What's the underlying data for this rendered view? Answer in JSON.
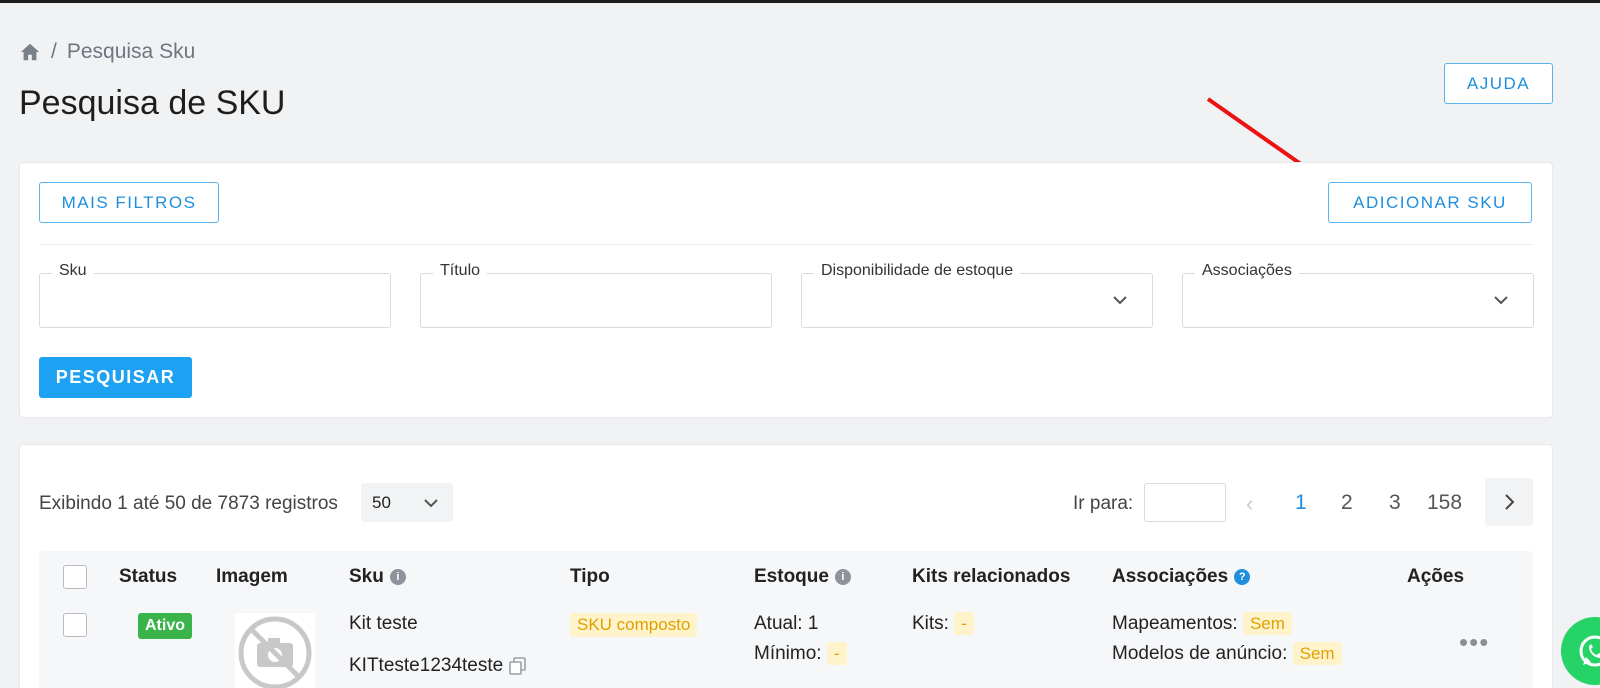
{
  "breadcrumb": {
    "home_icon": "home-icon",
    "separator": "/",
    "current": "Pesquisa Sku"
  },
  "page": {
    "title": "Pesquisa de SKU"
  },
  "header": {
    "help_label": "AJUDA"
  },
  "filters": {
    "more_filters_label": "MAIS FILTROS",
    "add_sku_label": "ADICIONAR SKU",
    "fields": [
      {
        "label": "Sku",
        "value": ""
      },
      {
        "label": "Título",
        "value": ""
      },
      {
        "label": "Disponibilidade de estoque",
        "value": ""
      },
      {
        "label": "Associações",
        "value": ""
      }
    ],
    "search_label": "PESQUISAR"
  },
  "results": {
    "showing_text": "Exibindo 1 até 50 de 7873 registros",
    "page_size": "50",
    "goto_label": "Ir para:",
    "prev_icon": "chevron-left-icon",
    "pages": [
      "1",
      "2",
      "3",
      "158"
    ],
    "current_page": "1",
    "next_icon": "chevron-right-icon"
  },
  "table": {
    "columns": [
      "Status",
      "Imagem",
      "Sku",
      "Tipo",
      "Estoque",
      "Kits relacionados",
      "Associações",
      "Ações"
    ],
    "rows": [
      {
        "status": "Ativo",
        "image_icon": "no-image-icon",
        "sku_title": "Kit teste",
        "sku_code": "KITteste1234teste",
        "type": "SKU composto",
        "stock_current": "Atual: 1",
        "stock_min_label": "Mínimo:",
        "stock_min_value": "-",
        "kits_label": "Kits:",
        "kits_value": "-",
        "mappings_label": "Mapeamentos:",
        "mappings_value": "Sem",
        "ad_models_label": "Modelos de anúncio:",
        "ad_models_value": "Sem",
        "actions_icon": "more-icon"
      }
    ]
  },
  "colors": {
    "accent": "#1da1f2",
    "success": "#3ab34a",
    "warning": "#e0a100",
    "annotation_arrow": "#ee1111",
    "whatsapp": "#25d366"
  }
}
